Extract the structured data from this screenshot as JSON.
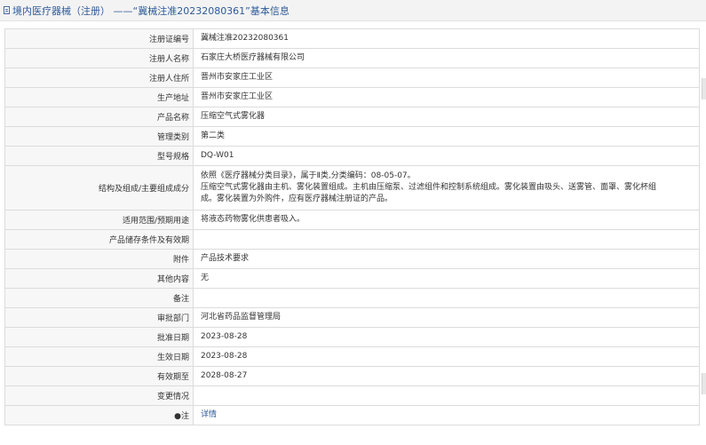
{
  "header": {
    "category": "境内医疗器械（注册）",
    "separator": " ——",
    "title": "“冀械注准20232080361”基本信息"
  },
  "rows": [
    {
      "label": "注册证编号",
      "value": "冀械注准20232080361"
    },
    {
      "label": "注册人名称",
      "value": "石家庄大桥医疗器械有限公司"
    },
    {
      "label": "注册人住所",
      "value": "晋州市安家庄工业区"
    },
    {
      "label": "生产地址",
      "value": "晋州市安家庄工业区"
    },
    {
      "label": "产品名称",
      "value": "压缩空气式雾化器"
    },
    {
      "label": "管理类别",
      "value": "第二类"
    },
    {
      "label": "型号规格",
      "value": "DQ-W01"
    },
    {
      "label": "结构及组成/主要组成成分",
      "lines": [
        "依照《医疗器械分类目录》，属于Ⅱ类,分类编码：08-05-07。",
        "压缩空气式雾化器由主机、雾化装置组成。主机由压缩泵、过滤组件和控制系统组成。雾化装置由吸头、送雾管、面罩、雾化杯组",
        "成。雾化装置为外购件，应有医疗器械注册证的产品。"
      ]
    },
    {
      "label": "适用范围/预期用途",
      "value": "将液态药物雾化供患者吸入。"
    },
    {
      "label": "产品储存条件及有效期",
      "value": ""
    },
    {
      "label": "附件",
      "value": "产品技术要求"
    },
    {
      "label": "其他内容",
      "value": "无"
    },
    {
      "label": "备注",
      "value": ""
    },
    {
      "label": "审批部门",
      "value": "河北省药品监督管理局"
    },
    {
      "label": "批准日期",
      "value": "2023-08-28"
    },
    {
      "label": "生效日期",
      "value": "2023-08-28"
    },
    {
      "label": "有效期至",
      "value": "2028-08-27"
    },
    {
      "label": "变更情况",
      "value": ""
    },
    {
      "label": "●注",
      "value": "详情"
    }
  ]
}
